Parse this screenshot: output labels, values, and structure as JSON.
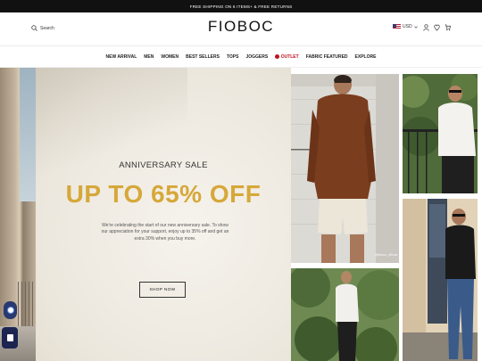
{
  "announcement": "FREE SHIPPING ON 6 ITEMS+ & FREE RETURNS",
  "header": {
    "search_label": "Search",
    "logo": "FIOBOC",
    "currency": "USD"
  },
  "nav": {
    "items": [
      "NEW ARRIVAL",
      "MEN",
      "WOMEN",
      "BEST SELLERS",
      "TOPS",
      "JOGGERS",
      "OUTLET",
      "FABRIC FEATURED",
      "EXPLORE"
    ]
  },
  "hero": {
    "eyebrow": "ANNIVERSARY SALE",
    "headline": "UP TO 65% OFF",
    "body": "We're celebrating the start of our new anniversary sale. To show our appreciation for your support, enjoy up to 35% off and get an extra 30% when you buy more.",
    "cta": "SHOP NOW"
  },
  "gallery": {
    "tag1": "@fioboc_official"
  },
  "colors": {
    "accent_gold": "#d6a83a",
    "outlet_red": "#c1121f",
    "announce_bg": "#111111"
  }
}
